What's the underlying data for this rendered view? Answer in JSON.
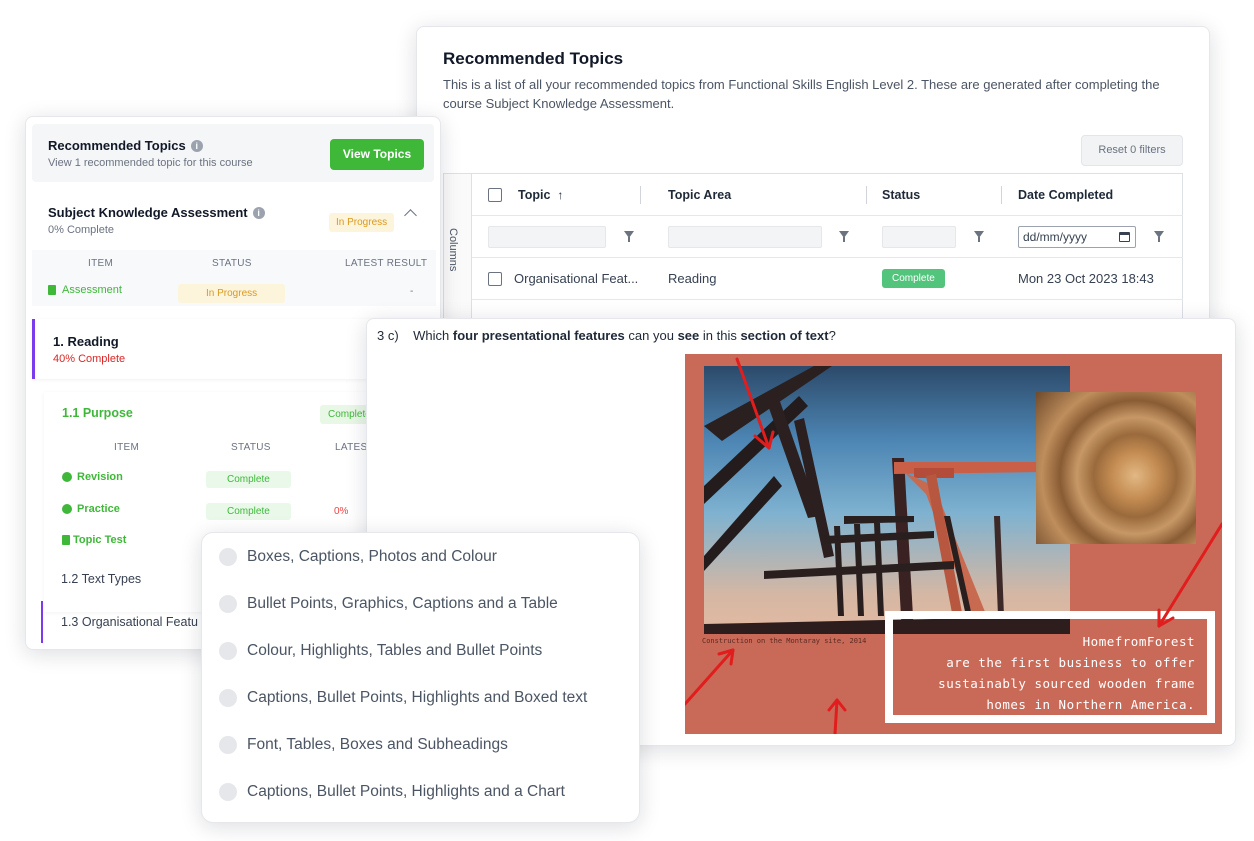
{
  "topics_panel": {
    "title": "Recommended Topics",
    "description": "This is a list of all your recommended topics from Functional Skills English Level 2. These are generated after completing the course Subject Knowledge Assessment.",
    "reset_button": "Reset 0 filters",
    "columns_tab": "Columns",
    "headers": {
      "topic": "Topic",
      "topic_area": "Topic Area",
      "status": "Status",
      "date_completed": "Date Completed"
    },
    "date_placeholder": "dd/mm/yyyy",
    "rows": [
      {
        "topic": "Organisational Feat...",
        "topic_area": "Reading",
        "status": "Complete",
        "date_completed": "Mon 23 Oct 2023 18:43"
      }
    ]
  },
  "progress_panel": {
    "recommended": {
      "title": "Recommended Topics",
      "subtitle": "View 1 recommended topic for this course",
      "button": "View Topics"
    },
    "ska": {
      "title": "Subject Knowledge Assessment",
      "subtitle": "0% Complete",
      "status": "In Progress",
      "headers": {
        "item": "ITEM",
        "status": "STATUS",
        "latest": "LATEST RESULT"
      },
      "rows": [
        {
          "item": "Assessment",
          "status": "In Progress",
          "result": "-"
        }
      ]
    },
    "reading": {
      "title": "1. Reading",
      "subtitle": "40% Complete"
    },
    "purpose": {
      "title": "1.1 Purpose",
      "status": "Complete",
      "headers": {
        "item": "ITEM",
        "status": "STATUS",
        "latest": "LATEST"
      },
      "rows": [
        {
          "item": "Revision",
          "status": "Complete",
          "result": ""
        },
        {
          "item": "Practice",
          "status": "Complete",
          "result": "0%"
        },
        {
          "item": "Topic Test",
          "status": "",
          "result": ""
        }
      ]
    },
    "text_types": "1.2 Text Types",
    "org_features": "1.3 Organisational Featu"
  },
  "question": {
    "number": "3 c)",
    "parts": [
      "Which ",
      "four presentational features",
      " can you ",
      "see",
      " in this ",
      "section of text",
      "?"
    ],
    "image_caption_small": "Construction on the Montaray site, 2014",
    "image_text": [
      "HomefromForest",
      "are the first business to offer",
      "sustainably sourced wooden frame",
      "homes in Northern America."
    ]
  },
  "options": [
    "Boxes, Captions, Photos and Colour",
    "Bullet Points, Graphics, Captions and a Table",
    "Colour, Highlights, Tables and Bullet Points",
    "Captions, Bullet Points, Highlights and Boxed text",
    "Font, Tables, Boxes and Subheadings",
    "Captions, Bullet Points, Highlights and a Chart"
  ],
  "colors": {
    "green": "#3fb83a",
    "purple": "#7c3aed",
    "red": "#dc2626",
    "amber": "#d99a1e",
    "image_bg": "#c96a58",
    "arrow": "#e11d1d"
  }
}
